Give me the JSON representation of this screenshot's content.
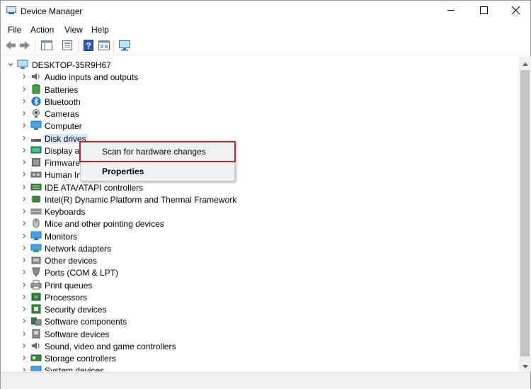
{
  "window": {
    "title": "Device Manager",
    "controls": {
      "minimize_icon": "minimize-icon",
      "maximize_icon": "maximize-icon",
      "close_icon": "close-icon"
    }
  },
  "menubar": {
    "file": "File",
    "action": "Action",
    "view": "View",
    "help": "Help"
  },
  "toolbar": {
    "buttons": [
      "back-arrow-icon",
      "forward-arrow-icon",
      "show-hide-console-tree-icon",
      "properties-icon",
      "help-icon",
      "view-icon",
      "scan-hardware-monitor-icon"
    ]
  },
  "tree": {
    "root": "DESKTOP-35R9H67",
    "selected_index": 5,
    "items": [
      {
        "label": "Audio inputs and outputs",
        "icon": "speaker-icon"
      },
      {
        "label": "Batteries",
        "icon": "battery-icon"
      },
      {
        "label": "Bluetooth",
        "icon": "bluetooth-icon"
      },
      {
        "label": "Cameras",
        "icon": "camera-icon"
      },
      {
        "label": "Computer",
        "icon": "computer-icon"
      },
      {
        "label": "Disk drives",
        "icon": "disk-drive-icon"
      },
      {
        "label": "Display ad",
        "icon": "display-adapter-icon"
      },
      {
        "label": "Firmware",
        "icon": "firmware-icon"
      },
      {
        "label": "Human In",
        "icon": "hid-icon"
      },
      {
        "label": "IDE ATA/ATAPI controllers",
        "icon": "ide-controller-icon"
      },
      {
        "label": "Intel(R) Dynamic Platform and Thermal Framework",
        "icon": "chip-icon"
      },
      {
        "label": "Keyboards",
        "icon": "keyboard-icon"
      },
      {
        "label": "Mice and other pointing devices",
        "icon": "mouse-icon"
      },
      {
        "label": "Monitors",
        "icon": "monitor-icon"
      },
      {
        "label": "Network adapters",
        "icon": "network-adapter-icon"
      },
      {
        "label": "Other devices",
        "icon": "other-devices-icon"
      },
      {
        "label": "Ports (COM & LPT)",
        "icon": "port-icon"
      },
      {
        "label": "Print queues",
        "icon": "printer-icon"
      },
      {
        "label": "Processors",
        "icon": "processor-icon"
      },
      {
        "label": "Security devices",
        "icon": "security-device-icon"
      },
      {
        "label": "Software components",
        "icon": "software-component-icon"
      },
      {
        "label": "Software devices",
        "icon": "software-device-icon"
      },
      {
        "label": "Sound, video and game controllers",
        "icon": "sound-icon"
      },
      {
        "label": "Storage controllers",
        "icon": "storage-controller-icon"
      },
      {
        "label": "System devices",
        "icon": "system-device-icon"
      }
    ]
  },
  "context_menu": {
    "scan": "Scan for hardware changes",
    "properties": "Properties",
    "highlight_color": "#c8232c"
  },
  "colors": {
    "selection": "#d9e8fb",
    "accent_blue": "#1e78d2"
  }
}
